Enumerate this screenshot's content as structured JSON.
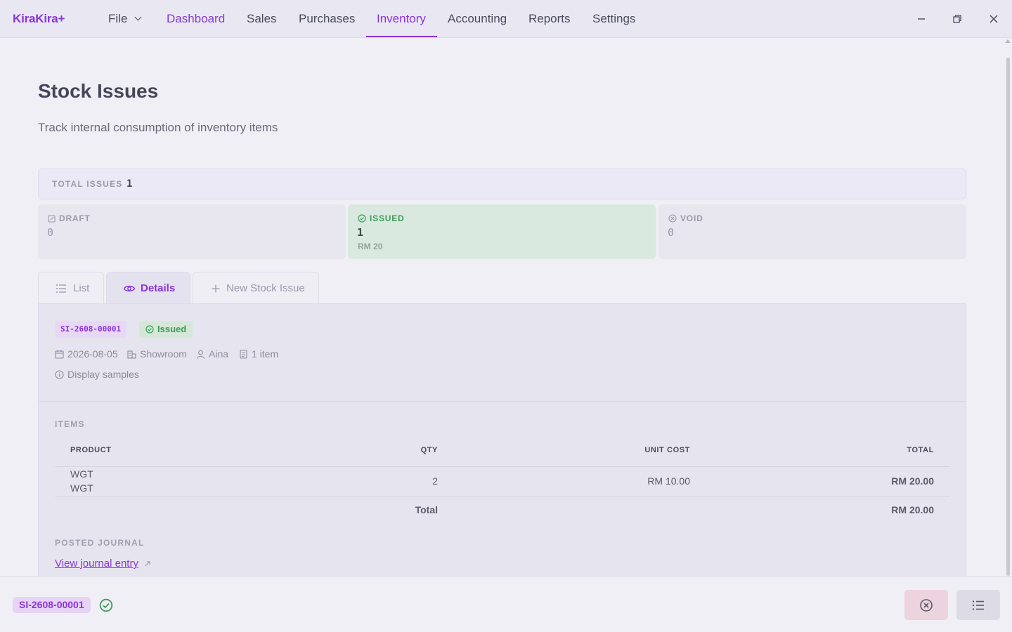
{
  "app": {
    "name": "KiraKira+"
  },
  "menu": {
    "file": "File",
    "items": [
      "Dashboard",
      "Sales",
      "Purchases",
      "Inventory",
      "Accounting",
      "Reports",
      "Settings"
    ],
    "active": "Inventory"
  },
  "window_controls": {
    "minimize": "minimize-icon",
    "restore": "restore-icon",
    "close": "close-icon"
  },
  "page": {
    "title": "Stock Issues",
    "subtitle": "Track internal consumption of inventory items"
  },
  "summary": {
    "total_label": "TOTAL ISSUES",
    "total_value": "1",
    "cards": {
      "draft": {
        "label": "DRAFT",
        "value": "0"
      },
      "issued": {
        "label": "ISSUED",
        "value": "1",
        "amount": "RM 20"
      },
      "void": {
        "label": "VOID",
        "value": "0"
      }
    }
  },
  "tabs": {
    "list": "List",
    "details": "Details",
    "new": "New Stock Issue",
    "active": "Details"
  },
  "detail": {
    "doc_number": "SI-2608-00001",
    "status": "Issued",
    "date": "2026-08-05",
    "location": "Showroom",
    "user": "Aina",
    "item_count": "1 item",
    "note": "Display samples",
    "items_label": "ITEMS",
    "columns": {
      "product": "PRODUCT",
      "qty": "QTY",
      "unit_cost": "UNIT COST",
      "total": "TOTAL"
    },
    "rows": [
      {
        "product_line1": "WGT",
        "product_line2": "WGT",
        "qty": "2",
        "unit_cost": "RM 10.00",
        "total": "RM 20.00"
      }
    ],
    "total_label": "Total",
    "total_value": "RM 20.00",
    "journal_label": "POSTED JOURNAL",
    "journal_link": "View journal entry"
  },
  "footer": {
    "doc_number": "SI-2608-00001"
  },
  "colors": {
    "accent": "#8a35d9",
    "success": "#3f9a58",
    "danger_bg": "#ecd3dd"
  }
}
